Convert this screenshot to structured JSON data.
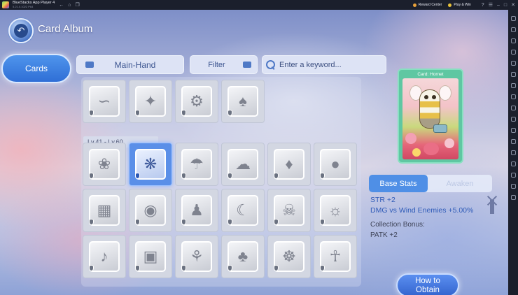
{
  "titlebar": {
    "app_title": "BlueStacks App Player 4",
    "version": "5.21.0.1022 P64",
    "reward_center": "Reward Center",
    "play_win": "Play & Win",
    "icons": [
      "back-icon",
      "home-icon",
      "copy-icon",
      "search-icon",
      "question-icon",
      "menu-icon",
      "minimize-icon",
      "maximize-icon",
      "close-icon"
    ]
  },
  "sidebar": {
    "icons": [
      "expand-icon",
      "keyboard-icon",
      "screen-icon",
      "fullscreen-icon",
      "gamepad-icon",
      "rotate-icon",
      "camera-icon",
      "record-icon",
      "apk-icon",
      "folder-icon",
      "macro-icon",
      "sync-icon",
      "eco-icon",
      "settings-icon",
      "back-icon",
      "home-icon",
      "recent-icon"
    ]
  },
  "header": {
    "title": "Card Album"
  },
  "tabs": {
    "cards": "Cards"
  },
  "toolbar": {
    "dropdown_label": "Main-Hand",
    "filter_label": "Filter",
    "search_placeholder": "Enter a keyword..."
  },
  "collection": {
    "level_label": "Lv.41 - Lv.60",
    "top_row": [
      "serpent",
      "creature",
      "machine",
      "witch"
    ],
    "grid_rows": [
      [
        "pinwheel",
        "hornet",
        "jellyfish",
        "ghost",
        "dragon",
        "gorilla"
      ],
      [
        "golem",
        "orb-creature",
        "brute",
        "scythe",
        "skull-mask",
        "lantern"
      ],
      [
        "dancer",
        "chest",
        "skeleton",
        "bunny",
        "mummy",
        "totem"
      ]
    ],
    "selected_card": "hornet"
  },
  "card_preview": {
    "title": "Card: Hornet"
  },
  "stats": {
    "tab_base": "Base Stats",
    "tab_awaken": "Awaken",
    "line1": "STR +2",
    "line2": "DMG vs Wind Enemies +5.00%",
    "bonus_title": "Collection Bonus:",
    "bonus_value": "PATK +2"
  },
  "obtain_button": {
    "line1": "How to",
    "line2": "Obtain"
  },
  "colors": {
    "accent": "#4f8fe6",
    "preview_border": "#5fc7a2",
    "stat_text": "#2f5bb8"
  }
}
